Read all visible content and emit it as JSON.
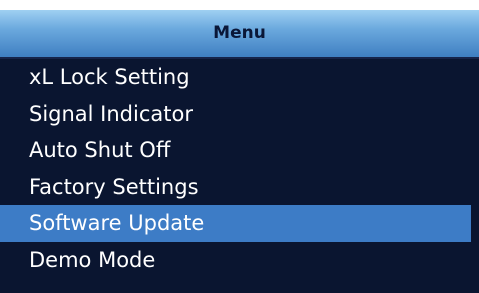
{
  "menu": {
    "title": "Menu",
    "items": [
      {
        "label": "xL Lock Setting",
        "selected": false
      },
      {
        "label": "Signal Indicator",
        "selected": false
      },
      {
        "label": "Auto Shut Off",
        "selected": false
      },
      {
        "label": "Factory Settings",
        "selected": false
      },
      {
        "label": "Software Update",
        "selected": true
      },
      {
        "label": "Demo Mode",
        "selected": false
      }
    ]
  },
  "colors": {
    "background": "#0a1530",
    "header_gradient_top": "#9fd0f2",
    "header_gradient_bottom": "#3f7fc2",
    "selection": "#3d7cc6",
    "text": "#ffffff",
    "header_text": "#0a1738"
  }
}
